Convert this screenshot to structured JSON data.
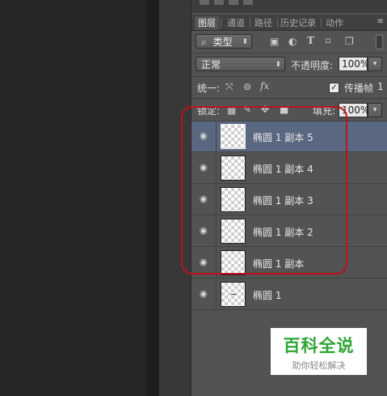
{
  "tabs": [
    {
      "label": "图层",
      "active": true
    },
    {
      "label": "通道",
      "active": false
    },
    {
      "label": "路径",
      "active": false
    },
    {
      "label": "历史记录",
      "active": false
    },
    {
      "label": "动作",
      "active": false
    }
  ],
  "panel_menu_icon": "≡",
  "filter": {
    "search_icon": "⌕",
    "kind_label": "类型"
  },
  "blend": {
    "mode": "正常",
    "opacity_label": "不透明度:",
    "opacity_value": "100%"
  },
  "unify": {
    "label": "统一:",
    "propagate_label": "传播帧",
    "frame_number": "1",
    "propagate_checked": true
  },
  "lock": {
    "label": "锁定:",
    "fill_label": "填充:",
    "fill_value": "100%"
  },
  "layers": [
    {
      "name": "椭圆 1 副本 5",
      "selected": true
    },
    {
      "name": "椭圆 1 副本 4",
      "selected": false
    },
    {
      "name": "椭圆 1 副本 3",
      "selected": false
    },
    {
      "name": "椭圆 1 副本 2",
      "selected": false
    },
    {
      "name": "椭圆 1 副本",
      "selected": false
    },
    {
      "name": "椭圆 1",
      "selected": false
    }
  ],
  "watermark": {
    "title": "百科全说",
    "subtitle": "助你轻松解决"
  },
  "colors": {
    "selected_row": "#5a6780",
    "annotation": "#c0101a",
    "watermark_green": "#2fa636"
  }
}
